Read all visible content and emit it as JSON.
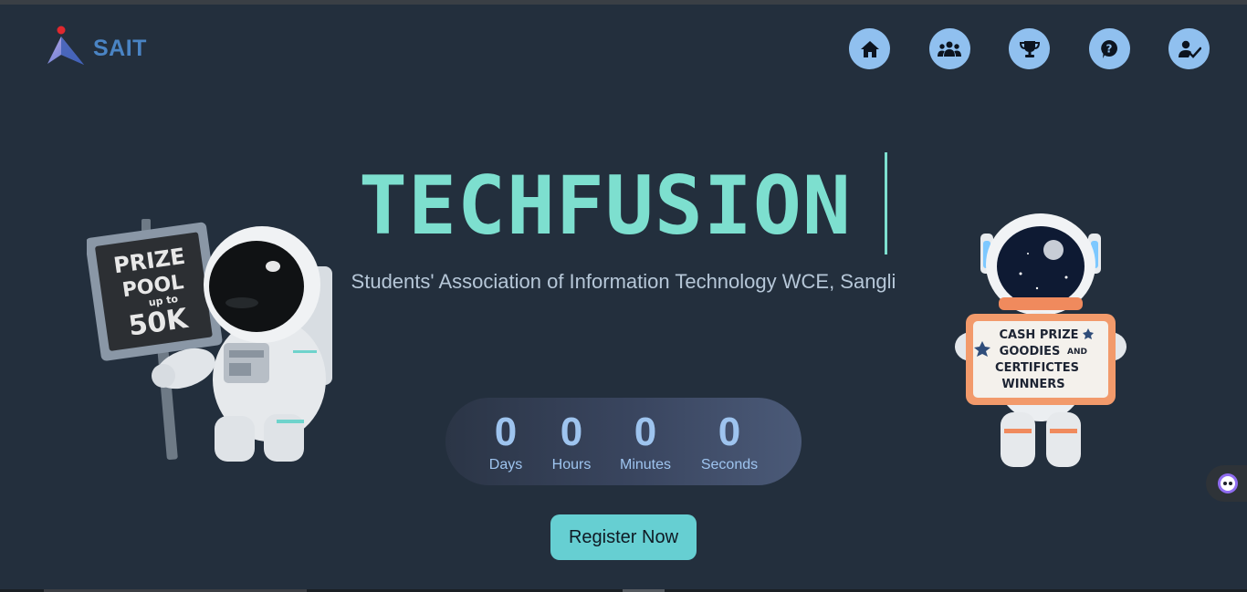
{
  "header": {
    "logo_text": "SAIT",
    "nav": [
      {
        "icon": "home-icon",
        "label": "Home"
      },
      {
        "icon": "team-icon",
        "label": "Team"
      },
      {
        "icon": "trophy-icon",
        "label": "Prizes"
      },
      {
        "icon": "help-icon",
        "label": "FAQ"
      },
      {
        "icon": "register-user-icon",
        "label": "Register"
      }
    ]
  },
  "hero": {
    "title": "TECHFUSION",
    "subtitle": "Students' Association of Information Technology WCE, Sangli"
  },
  "countdown": {
    "days": "0",
    "days_label": "Days",
    "hours": "0",
    "hours_label": "Hours",
    "minutes": "0",
    "minutes_label": "Minutes",
    "seconds": "0",
    "seconds_label": "Seconds"
  },
  "register_label": "Register Now",
  "left_sign": {
    "line1": "PRIZE",
    "line2": "POOL",
    "line3": "up to",
    "line4": "50K"
  },
  "right_sign": {
    "line1": "CASH PRIZE",
    "line2": "GOODIES",
    "line2b": "AND",
    "line3": "CERTIFICTES",
    "line4": "WINNERS"
  },
  "colors": {
    "background": "#232f3d",
    "accent": "#7ddfcf",
    "nav_button": "#90c0ef",
    "register_button": "#66cfd2"
  }
}
